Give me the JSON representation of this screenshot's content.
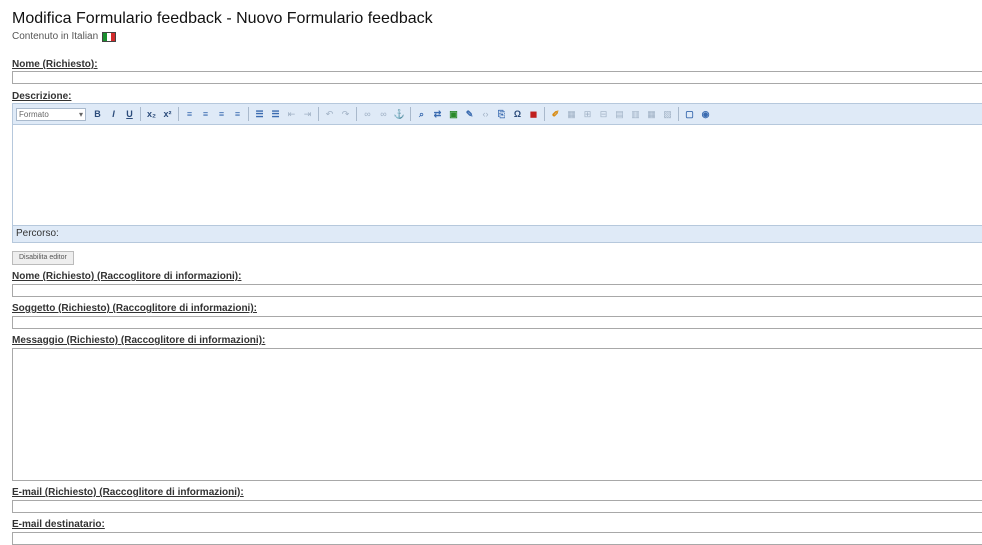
{
  "header": {
    "title": "Modifica Formulario feedback - Nuovo Formulario feedback",
    "subtitle": "Contenuto in Italian",
    "flag_icon": "italian-flag-icon"
  },
  "fields": {
    "nome": {
      "label": "Nome (Richiesto):",
      "value": ""
    },
    "descrizione": {
      "label": "Descrizione:",
      "value": ""
    },
    "nome_raccoglitore": {
      "label": "Nome (Richiesto) (Raccoglitore di informazioni):",
      "value": ""
    },
    "soggetto": {
      "label": "Soggetto (Richiesto) (Raccoglitore di informazioni):",
      "value": ""
    },
    "messaggio": {
      "label": "Messaggio (Richiesto) (Raccoglitore di informazioni):",
      "value": ""
    },
    "email": {
      "label": "E-mail (Richiesto) (Raccoglitore di informazioni):",
      "value": ""
    },
    "email_destinatario": {
      "label": "E-mail destinatario:",
      "value": ""
    }
  },
  "editor": {
    "format_label": "Formato",
    "path_label": "Percorso:",
    "disable_button": "Disabilita editor",
    "toolbar": {
      "bold": "B",
      "italic": "I",
      "underline": "U",
      "subscript": "x₂",
      "superscript": "x²",
      "special_char": "Ω"
    }
  }
}
